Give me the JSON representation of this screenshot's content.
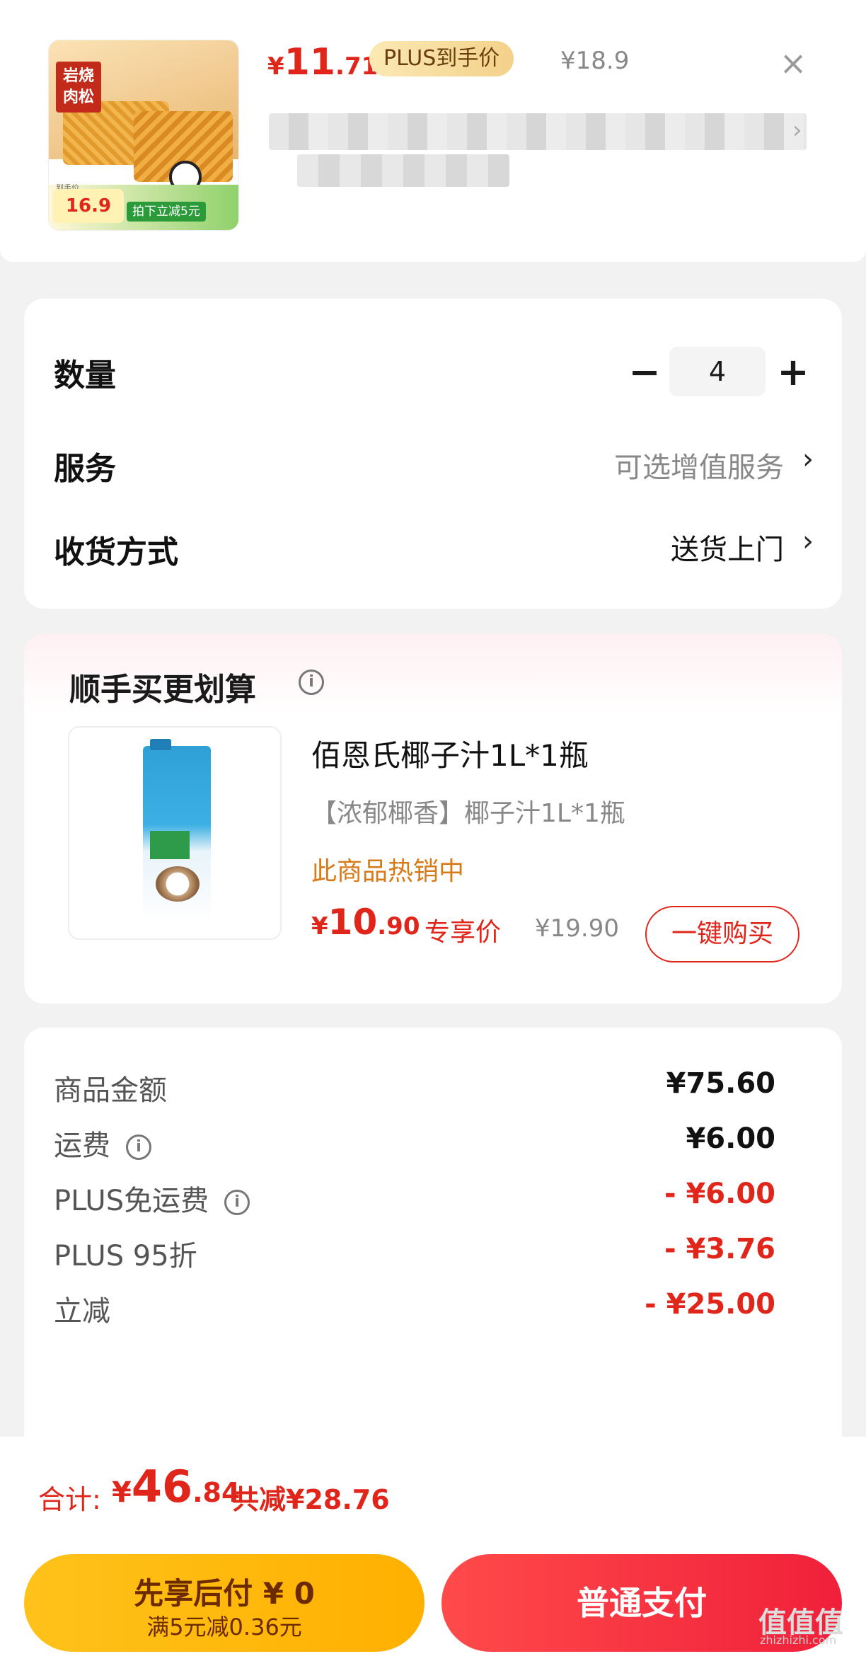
{
  "product": {
    "thumb_brand": "岩烧\n肉松",
    "thumb_hand_label": "到手价",
    "thumb_hand_price": "16.9",
    "thumb_save": "拍下立减5元",
    "price_symbol": "¥",
    "price_int": "11",
    "price_dec": ".71",
    "plus_tag": "PLUS到手价",
    "original_price": "¥18.9"
  },
  "options": {
    "quantity_label": "数量",
    "quantity_value": "4",
    "minus": "−",
    "plus": "+",
    "service_label": "服务",
    "service_value": "可选增值服务",
    "delivery_label": "收货方式",
    "delivery_value": "送货上门",
    "chevron": "›"
  },
  "upsell": {
    "title": "顺手买更划算",
    "name": "佰恩氏椰子汁1L*1瓶",
    "subtitle": "【浓郁椰香】椰子汁1L*1瓶",
    "hot": "此商品热销中",
    "price_symbol": "¥",
    "price_int": "10",
    "price_dec": ".90",
    "exclusive": "专享价",
    "original_price": "¥19.90",
    "buy_button": "一键购买"
  },
  "summary": {
    "rows": [
      {
        "label": "商品金额",
        "value": "¥75.60",
        "info": false,
        "red": false
      },
      {
        "label": "运费",
        "value": "¥6.00",
        "info": true,
        "red": false
      },
      {
        "label": "PLUS免运费",
        "value": "- ¥6.00",
        "info": true,
        "red": true
      },
      {
        "label": "PLUS 95折",
        "value": "- ¥3.76",
        "info": false,
        "red": true
      },
      {
        "label": "立减",
        "value": "- ¥25.00",
        "info": false,
        "red": true
      }
    ]
  },
  "footer": {
    "total_label": "合计:",
    "total_symbol": "¥",
    "total_int": "46",
    "total_dec": ".84",
    "total_saved": "共减¥28.76",
    "later_title": "先享后付 ¥ 0",
    "later_sub": "满5元减0.36元",
    "pay_button": "普通支付"
  },
  "watermark": {
    "main": "值值值",
    "sub": "zhizhizhi.com"
  },
  "colors": {
    "accent_red": "#e0251b",
    "plus_gold": "#f3d18a",
    "pay_later_yellow": "#ffc21a",
    "hot_orange": "#d77a1a"
  },
  "icons": {
    "close": "close-icon",
    "info": "info-circle-icon",
    "chevron": "chevron-right-icon"
  }
}
